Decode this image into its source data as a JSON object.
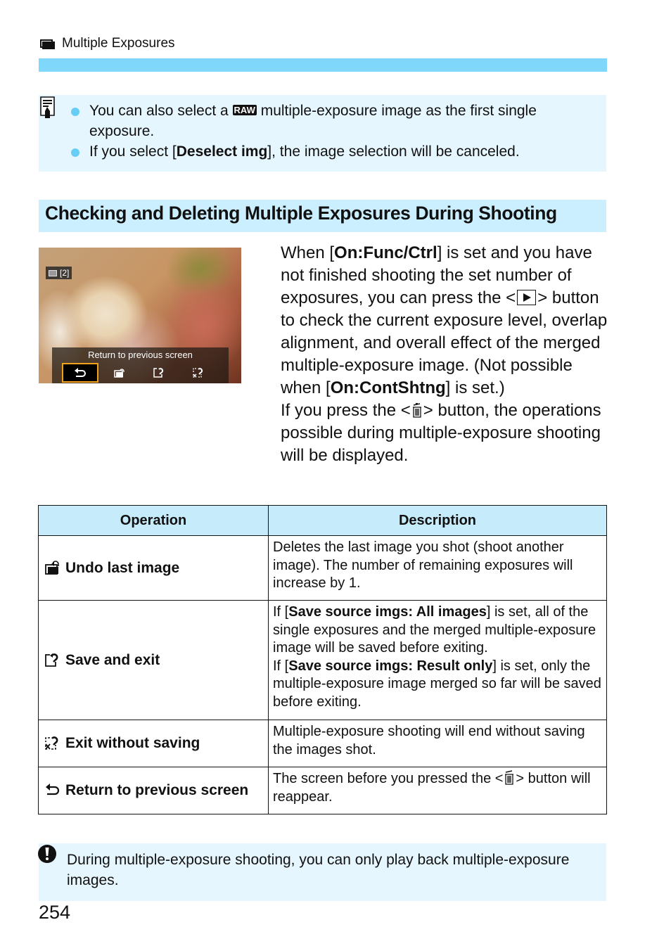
{
  "header": {
    "icon": "multiple-exposure-icon",
    "title": "Multiple Exposures",
    "accent_color": "#7fd7fb"
  },
  "note": {
    "icon": "memo-icon",
    "items": [
      {
        "before": "You can also select a ",
        "badge": "RAW",
        "after": " multiple-exposure image as the first single exposure."
      },
      {
        "before": "If you select [",
        "bold": "Deselect img",
        "after": "], the image selection will be canceled."
      }
    ]
  },
  "section": {
    "title": "Checking and Deleting Multiple Exposures During Shooting"
  },
  "camera_screen": {
    "badge_count": "[2]",
    "panel_title": "Return to previous screen",
    "options": [
      {
        "icon": "return-icon",
        "glyph": "⮌",
        "selected": true
      },
      {
        "icon": "undo-last-image-icon",
        "glyph": "",
        "selected": false
      },
      {
        "icon": "save-and-exit-icon",
        "glyph": "",
        "selected": false
      },
      {
        "icon": "exit-without-saving-icon",
        "glyph": "",
        "selected": false
      }
    ],
    "selection_color": "#f2a11d"
  },
  "body": {
    "p1_a": "When [",
    "p1_bold": "On:Func/Ctrl",
    "p1_b": "] is set and you have not finished shooting the set number of exposures, you can press the <",
    "p1_c": "> button to check the current exposure level, overlap alignment, and overall effect of the merged multiple-exposure image. (Not possible when [",
    "p1_bold2": "On:ContShtng",
    "p1_d": "] is set.)",
    "p2_a": "If you press the <",
    "p2_b": "> button, the operations possible during multiple-exposure shooting will be displayed."
  },
  "table": {
    "headers": [
      "Operation",
      "Description"
    ],
    "rows": [
      {
        "icon": "undo-last-image-icon",
        "operation": "Undo last image",
        "description": "Deletes the last image you shot (shoot another image). The number of remaining exposures will increase by 1."
      },
      {
        "icon": "save-and-exit-icon",
        "operation": "Save and exit",
        "d1_a": "If [",
        "d1_bold": "Save source imgs: All images",
        "d1_b": "] is set, all of the single exposures and the merged multiple-exposure image will be saved before exiting.",
        "d2_a": "If [",
        "d2_bold": "Save source imgs: Result only",
        "d2_b": "] is set, only the multiple-exposure image merged so far will be saved before exiting."
      },
      {
        "icon": "exit-without-saving-icon",
        "operation": "Exit without saving",
        "description": "Multiple-exposure shooting will end without saving the images shot."
      },
      {
        "icon": "return-icon",
        "operation": "Return to previous screen",
        "d_a": "The screen before you pressed the <",
        "d_b": "> button will reappear."
      }
    ],
    "header_color": "#c6ecfc"
  },
  "caution": {
    "icon": "caution-icon",
    "text": "During multiple-exposure shooting, you can only play back multiple-exposure images."
  },
  "page_number": "254"
}
